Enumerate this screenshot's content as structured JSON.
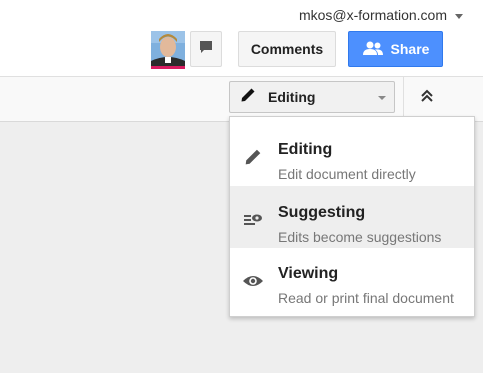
{
  "account": {
    "email": "mkos@x-formation.com"
  },
  "header": {
    "comments_label": "Comments",
    "share_label": "Share"
  },
  "toolbar": {
    "mode_label": "Editing"
  },
  "mode_menu": {
    "items": [
      {
        "title": "Editing",
        "description": "Edit document directly",
        "icon": "pencil-icon",
        "active": false
      },
      {
        "title": "Suggesting",
        "description": "Edits become suggestions",
        "icon": "suggest-icon",
        "active": true
      },
      {
        "title": "Viewing",
        "description": "Read or print final document",
        "icon": "eye-icon",
        "active": false
      }
    ]
  },
  "colors": {
    "share_blue": "#4d90fe",
    "menu_highlight": "#eeeeee",
    "icon_gray": "#555555"
  }
}
